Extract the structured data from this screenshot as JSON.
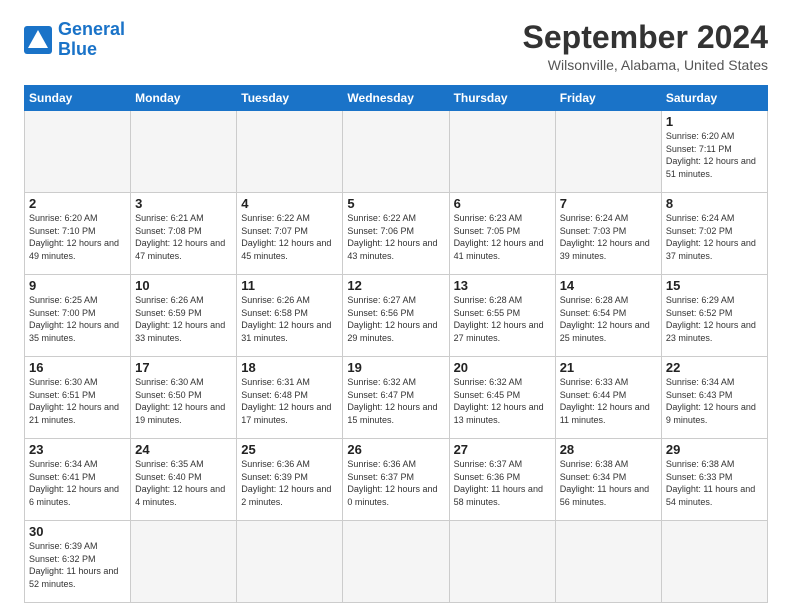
{
  "header": {
    "logo_line1": "General",
    "logo_line2": "Blue",
    "month_title": "September 2024",
    "subtitle": "Wilsonville, Alabama, United States"
  },
  "weekdays": [
    "Sunday",
    "Monday",
    "Tuesday",
    "Wednesday",
    "Thursday",
    "Friday",
    "Saturday"
  ],
  "days": [
    {
      "day": "",
      "empty": true
    },
    {
      "day": "",
      "empty": true
    },
    {
      "day": "",
      "empty": true
    },
    {
      "day": "",
      "empty": true
    },
    {
      "day": "",
      "empty": true
    },
    {
      "day": "",
      "empty": true
    },
    {
      "day": "1",
      "sunrise": "Sunrise: 6:20 AM",
      "sunset": "Sunset: 7:11 PM",
      "daylight": "Daylight: 12 hours and 51 minutes."
    },
    {
      "day": "2",
      "sunrise": "Sunrise: 6:20 AM",
      "sunset": "Sunset: 7:10 PM",
      "daylight": "Daylight: 12 hours and 49 minutes."
    },
    {
      "day": "3",
      "sunrise": "Sunrise: 6:21 AM",
      "sunset": "Sunset: 7:08 PM",
      "daylight": "Daylight: 12 hours and 47 minutes."
    },
    {
      "day": "4",
      "sunrise": "Sunrise: 6:22 AM",
      "sunset": "Sunset: 7:07 PM",
      "daylight": "Daylight: 12 hours and 45 minutes."
    },
    {
      "day": "5",
      "sunrise": "Sunrise: 6:22 AM",
      "sunset": "Sunset: 7:06 PM",
      "daylight": "Daylight: 12 hours and 43 minutes."
    },
    {
      "day": "6",
      "sunrise": "Sunrise: 6:23 AM",
      "sunset": "Sunset: 7:05 PM",
      "daylight": "Daylight: 12 hours and 41 minutes."
    },
    {
      "day": "7",
      "sunrise": "Sunrise: 6:24 AM",
      "sunset": "Sunset: 7:03 PM",
      "daylight": "Daylight: 12 hours and 39 minutes."
    },
    {
      "day": "8",
      "sunrise": "Sunrise: 6:24 AM",
      "sunset": "Sunset: 7:02 PM",
      "daylight": "Daylight: 12 hours and 37 minutes."
    },
    {
      "day": "9",
      "sunrise": "Sunrise: 6:25 AM",
      "sunset": "Sunset: 7:00 PM",
      "daylight": "Daylight: 12 hours and 35 minutes."
    },
    {
      "day": "10",
      "sunrise": "Sunrise: 6:26 AM",
      "sunset": "Sunset: 6:59 PM",
      "daylight": "Daylight: 12 hours and 33 minutes."
    },
    {
      "day": "11",
      "sunrise": "Sunrise: 6:26 AM",
      "sunset": "Sunset: 6:58 PM",
      "daylight": "Daylight: 12 hours and 31 minutes."
    },
    {
      "day": "12",
      "sunrise": "Sunrise: 6:27 AM",
      "sunset": "Sunset: 6:56 PM",
      "daylight": "Daylight: 12 hours and 29 minutes."
    },
    {
      "day": "13",
      "sunrise": "Sunrise: 6:28 AM",
      "sunset": "Sunset: 6:55 PM",
      "daylight": "Daylight: 12 hours and 27 minutes."
    },
    {
      "day": "14",
      "sunrise": "Sunrise: 6:28 AM",
      "sunset": "Sunset: 6:54 PM",
      "daylight": "Daylight: 12 hours and 25 minutes."
    },
    {
      "day": "15",
      "sunrise": "Sunrise: 6:29 AM",
      "sunset": "Sunset: 6:52 PM",
      "daylight": "Daylight: 12 hours and 23 minutes."
    },
    {
      "day": "16",
      "sunrise": "Sunrise: 6:30 AM",
      "sunset": "Sunset: 6:51 PM",
      "daylight": "Daylight: 12 hours and 21 minutes."
    },
    {
      "day": "17",
      "sunrise": "Sunrise: 6:30 AM",
      "sunset": "Sunset: 6:50 PM",
      "daylight": "Daylight: 12 hours and 19 minutes."
    },
    {
      "day": "18",
      "sunrise": "Sunrise: 6:31 AM",
      "sunset": "Sunset: 6:48 PM",
      "daylight": "Daylight: 12 hours and 17 minutes."
    },
    {
      "day": "19",
      "sunrise": "Sunrise: 6:32 AM",
      "sunset": "Sunset: 6:47 PM",
      "daylight": "Daylight: 12 hours and 15 minutes."
    },
    {
      "day": "20",
      "sunrise": "Sunrise: 6:32 AM",
      "sunset": "Sunset: 6:45 PM",
      "daylight": "Daylight: 12 hours and 13 minutes."
    },
    {
      "day": "21",
      "sunrise": "Sunrise: 6:33 AM",
      "sunset": "Sunset: 6:44 PM",
      "daylight": "Daylight: 12 hours and 11 minutes."
    },
    {
      "day": "22",
      "sunrise": "Sunrise: 6:34 AM",
      "sunset": "Sunset: 6:43 PM",
      "daylight": "Daylight: 12 hours and 9 minutes."
    },
    {
      "day": "23",
      "sunrise": "Sunrise: 6:34 AM",
      "sunset": "Sunset: 6:41 PM",
      "daylight": "Daylight: 12 hours and 6 minutes."
    },
    {
      "day": "24",
      "sunrise": "Sunrise: 6:35 AM",
      "sunset": "Sunset: 6:40 PM",
      "daylight": "Daylight: 12 hours and 4 minutes."
    },
    {
      "day": "25",
      "sunrise": "Sunrise: 6:36 AM",
      "sunset": "Sunset: 6:39 PM",
      "daylight": "Daylight: 12 hours and 2 minutes."
    },
    {
      "day": "26",
      "sunrise": "Sunrise: 6:36 AM",
      "sunset": "Sunset: 6:37 PM",
      "daylight": "Daylight: 12 hours and 0 minutes."
    },
    {
      "day": "27",
      "sunrise": "Sunrise: 6:37 AM",
      "sunset": "Sunset: 6:36 PM",
      "daylight": "Daylight: 11 hours and 58 minutes."
    },
    {
      "day": "28",
      "sunrise": "Sunrise: 6:38 AM",
      "sunset": "Sunset: 6:34 PM",
      "daylight": "Daylight: 11 hours and 56 minutes."
    },
    {
      "day": "29",
      "sunrise": "Sunrise: 6:38 AM",
      "sunset": "Sunset: 6:33 PM",
      "daylight": "Daylight: 11 hours and 54 minutes."
    },
    {
      "day": "30",
      "sunrise": "Sunrise: 6:39 AM",
      "sunset": "Sunset: 6:32 PM",
      "daylight": "Daylight: 11 hours and 52 minutes."
    },
    {
      "day": "",
      "empty": true
    },
    {
      "day": "",
      "empty": true
    },
    {
      "day": "",
      "empty": true
    },
    {
      "day": "",
      "empty": true
    },
    {
      "day": "",
      "empty": true
    }
  ]
}
